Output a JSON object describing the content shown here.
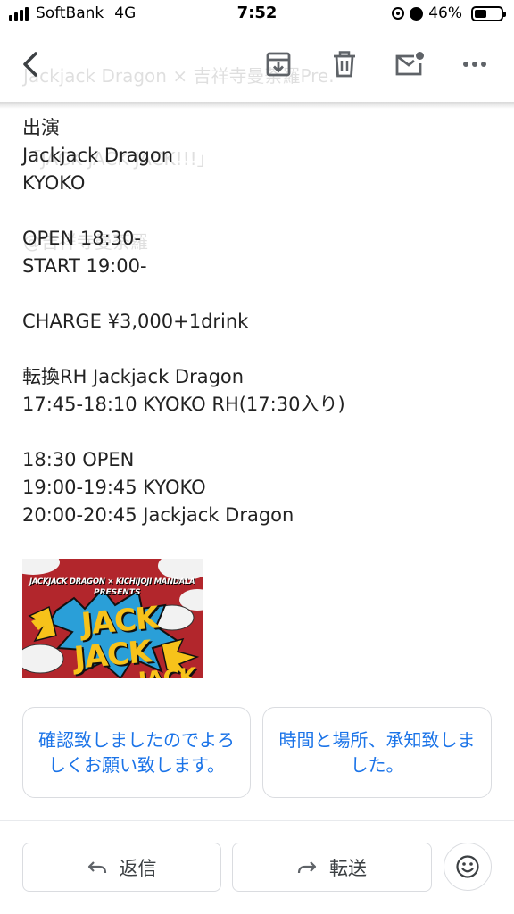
{
  "status_bar": {
    "carrier": "SoftBank",
    "network": "4G",
    "time": "7:52",
    "battery": "46%"
  },
  "subject_ghost": [
    "Jackjack Dragon × 吉祥寺曼荼羅Pre.",
    "「JACK JACK JACK!!!」",
    "@吉祥寺曼荼羅"
  ],
  "toolbar": {
    "icons": [
      "back-icon",
      "archive-icon",
      "trash-icon",
      "mark-unread-icon",
      "more-icon"
    ]
  },
  "body_lines": [
    "出演",
    "Jackjack Dragon",
    "KYOKO",
    "",
    "OPEN 18:30-",
    "START 19:00-",
    "",
    "CHARGE ¥3,000+1drink",
    "",
    "転換RH Jackjack Dragon",
    "17:45-18:10 KYOKO RH(17:30入り)",
    "",
    "18:30 OPEN",
    "19:00-19:45 KYOKO",
    "20:00-20:45 Jackjack Dragon"
  ],
  "poster": {
    "header": "JACKJACK DRAGON × KICHIJOJI MANDALA",
    "presents": "PRESENTS",
    "word1": "JACK",
    "word2": "JACK",
    "word3": "JACK"
  },
  "smart_replies": [
    "確認致しましたのでよろしくお願い致します。",
    "時間と場所、承知致しました。"
  ],
  "actions": {
    "reply": "返信",
    "forward": "転送"
  },
  "colors": {
    "accent": "#1a73e8",
    "border": "#dadce0",
    "poster_red": "#b2262c",
    "poster_yellow": "#f7c21a",
    "poster_blue": "#2a9fd8"
  }
}
